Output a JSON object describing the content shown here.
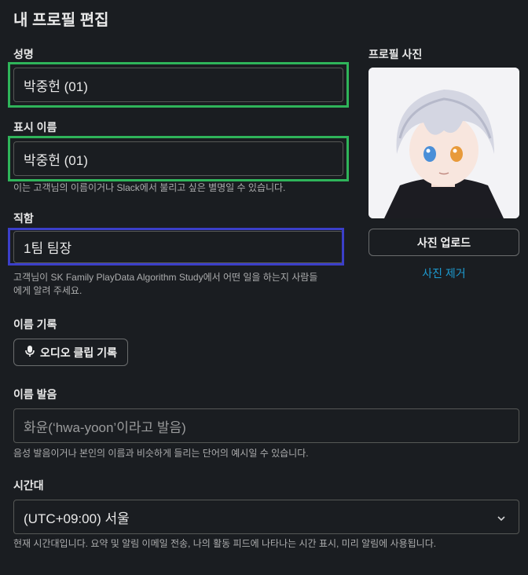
{
  "page": {
    "title": "내 프로필 편집"
  },
  "full_name": {
    "label": "성명",
    "value": "박중헌 (01)"
  },
  "display_name": {
    "label": "표시 이름",
    "value": "박중헌 (01)",
    "hint": "이는 고객님의 이름이거나 Slack에서 불리고 싶은 별명일 수 있습니다."
  },
  "job_title": {
    "label": "직함",
    "value": "1팀 팀장",
    "hint_line1": "고객님이 SK Family PlayData Algorithm Study에서 어떤 일을 하는지 사람들",
    "hint_line2": "에게 알려 주세요."
  },
  "name_recording": {
    "label": "이름 기록",
    "button": "오디오 클립 기록"
  },
  "pronunciation": {
    "label": "이름 발음",
    "placeholder": "화윤(‘hwa-yoon’이라고 발음)",
    "hint": "음성 발음이거나 본인의 이름과 비슷하게 들리는 단어의 예시일 수 있습니다."
  },
  "timezone": {
    "label": "시간대",
    "selected": "(UTC+09:00) 서울",
    "hint": "현재 시간대입니다. 요약 및 알림 이메일 전송, 나의 활동 피드에 나타나는 시간 표시, 미리 알림에 사용됩니다."
  },
  "profile_photo": {
    "label": "프로필 사진",
    "upload_button": "사진 업로드",
    "remove_link": "사진 제거"
  },
  "colors": {
    "highlight_green": "#2fb45a",
    "highlight_blue": "#3b3fc9",
    "link": "#1d9bd1",
    "background": "#1a1d21"
  }
}
